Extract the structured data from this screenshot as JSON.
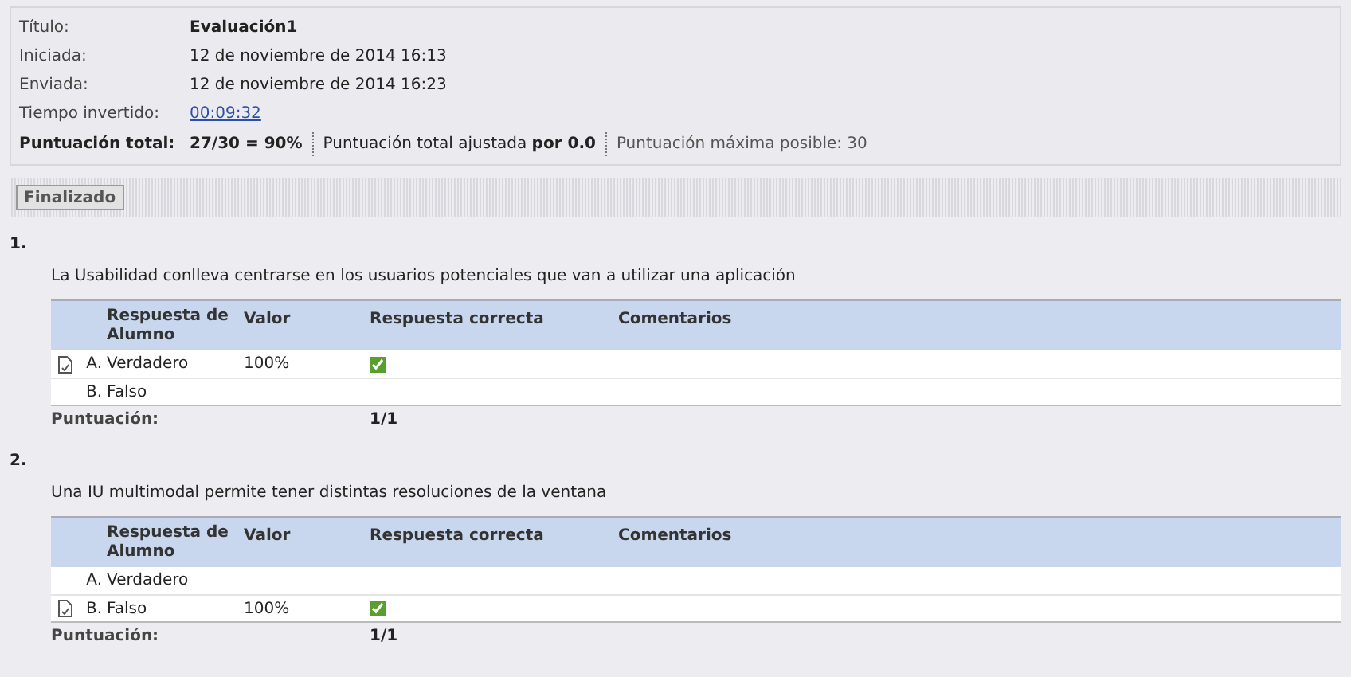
{
  "summary": {
    "rows": [
      {
        "label": "Título:",
        "value": "Evaluación1",
        "kind": "bold"
      },
      {
        "label": "Iniciada:",
        "value": "12 de noviembre de 2014 16:13",
        "kind": "text"
      },
      {
        "label": "Enviada:",
        "value": "12 de noviembre de 2014 16:23",
        "kind": "text"
      },
      {
        "label": "Tiempo invertido:",
        "value": "00:09:32",
        "kind": "link"
      }
    ],
    "total_label": "Puntuación total:",
    "total_value": "27/30 = 90%",
    "adjusted": "Puntuación total ajustada **por 0.0**",
    "max": "Puntuación máxima posible: 30"
  },
  "status_button": "Finalizado",
  "questions": [
    {
      "number": "1.",
      "columns": [
        "Respuesta de Alumno",
        "Valor",
        "Respuesta correcta",
        "Comentarios"
      ],
      "text": "La Usabilidad conlleva centrarse en los usuarios potenciales que van a utilizar una aplicación",
      "score_label": "Puntuación:",
      "score": "1/1",
      "answers": [
        {
          "letter": "A.",
          "text": "Verdadero",
          "chosen": true,
          "value": "100%",
          "correct": true
        },
        {
          "letter": "B.",
          "text": "Falso",
          "chosen": false,
          "correct": false
        }
      ]
    },
    {
      "number": "2.",
      "columns": [
        "Respuesta de Alumno",
        "Valor",
        "Respuesta correcta",
        "Comentarios"
      ],
      "text": "Una IU multimodal permite tener distintas resoluciones de la ventana",
      "score_label": "Puntuación:",
      "score": "1/1",
      "answers": [
        {
          "letter": "A.",
          "text": "Verdadero",
          "chosen": false,
          "correct": false
        },
        {
          "letter": "B.",
          "text": "Falso",
          "chosen": true,
          "value": "100%",
          "correct": true
        }
      ]
    }
  ]
}
